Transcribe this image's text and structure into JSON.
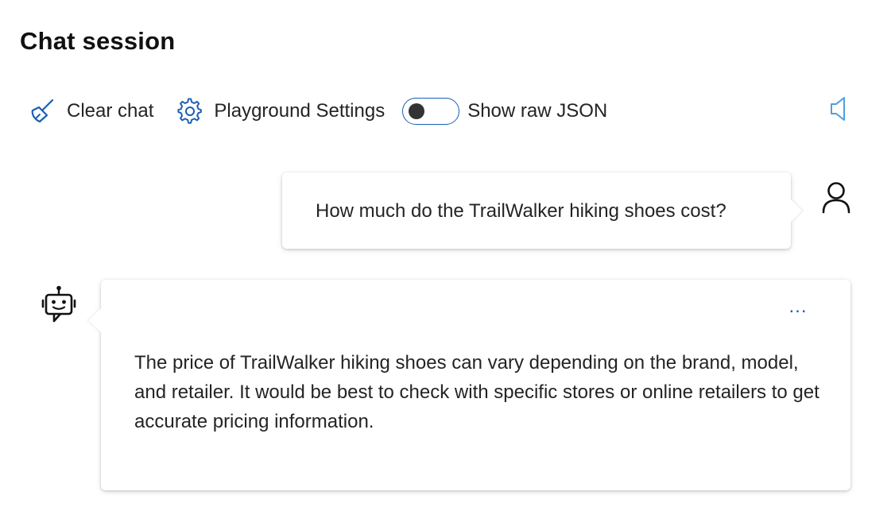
{
  "page": {
    "title": "Chat session"
  },
  "toolbar": {
    "clear_chat_label": "Clear chat",
    "settings_label": "Playground Settings",
    "raw_json_label": "Show raw JSON",
    "raw_json_enabled": false
  },
  "messages": [
    {
      "role": "user",
      "text": "How much do the TrailWalker hiking shoes cost?"
    },
    {
      "role": "assistant",
      "text": "The price of TrailWalker hiking shoes can vary depending on the brand, model, and retailer. It would be best to check with specific stores or online retailers to get accurate pricing information.",
      "more_label": "..."
    }
  ],
  "icons": {
    "clear_chat": "broom-icon",
    "settings": "gear-icon",
    "speaker": "speaker-icon",
    "user": "person-icon",
    "assistant": "bot-icon"
  },
  "colors": {
    "accent": "#1a5fb4",
    "icon_blue": "#1a5fb4",
    "speaker_blue": "#4f9fe0"
  }
}
